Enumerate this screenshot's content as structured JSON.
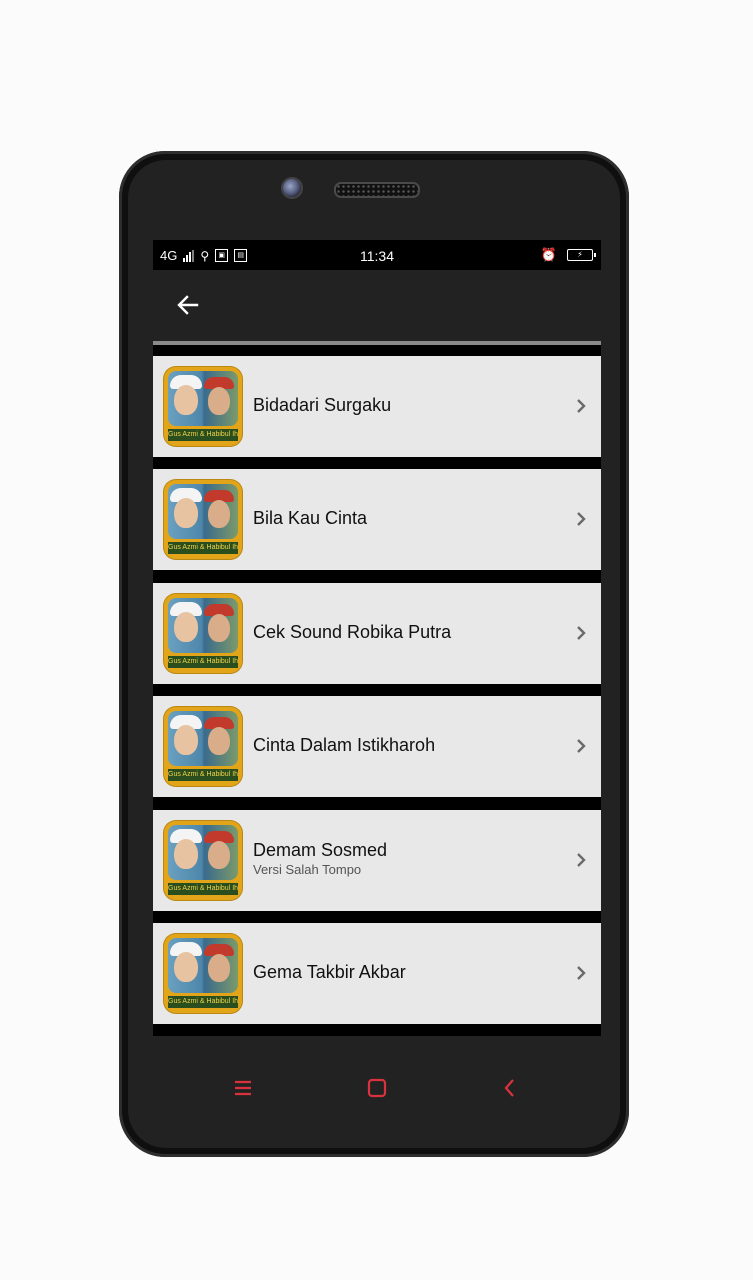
{
  "status_bar": {
    "network": "4G",
    "time": "11:34"
  },
  "app_bar": {
    "back_icon": "arrow-left-icon"
  },
  "list": {
    "items": [
      {
        "title": "Bidadari Surgaku",
        "subtitle": ""
      },
      {
        "title": "Bila Kau Cinta",
        "subtitle": ""
      },
      {
        "title": "Cek Sound Robika Putra",
        "subtitle": ""
      },
      {
        "title": "Cinta Dalam Istikharoh",
        "subtitle": ""
      },
      {
        "title": "Demam Sosmed",
        "subtitle": "Versi Salah Tompo"
      },
      {
        "title": "Gema Takbir Akbar",
        "subtitle": ""
      }
    ],
    "thumbnail_caption": "Gus Azmi & Habibul Ihsan",
    "chevron_icon": "chevron-right-icon"
  },
  "nav": {
    "menu_icon": "menu-icon",
    "home_icon": "home-square-icon",
    "back_icon": "back-chevron-icon",
    "accent": "#d9323e"
  },
  "colors": {
    "row_bg": "#e8e8e8",
    "app_bar": "#222222",
    "screen_bg": "#000000"
  }
}
